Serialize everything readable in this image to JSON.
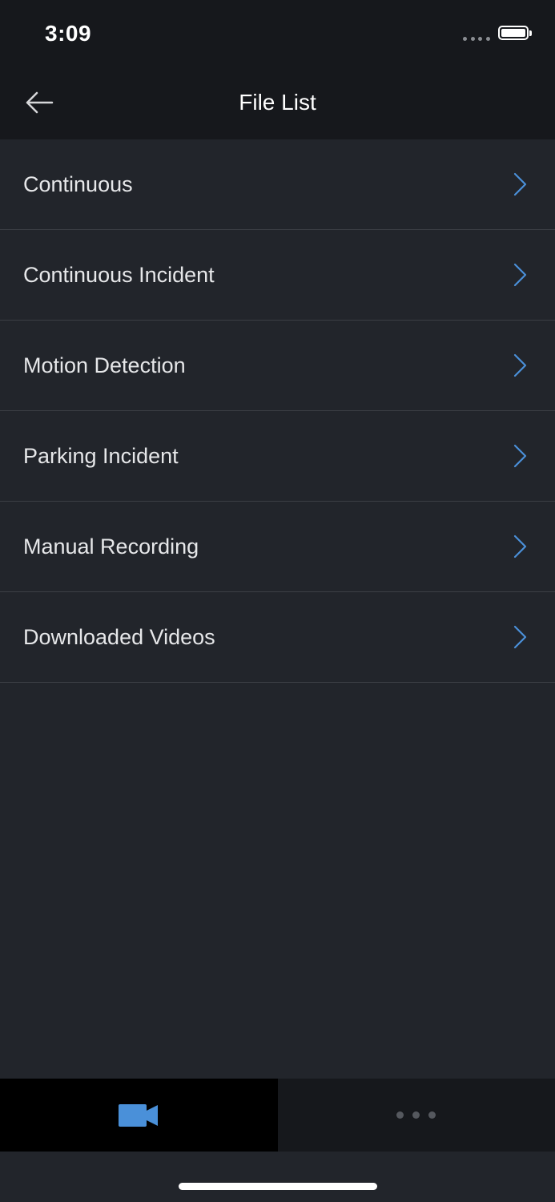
{
  "status_bar": {
    "time": "3:09"
  },
  "nav": {
    "title": "File List",
    "back_icon": "arrow-left-icon"
  },
  "file_list": {
    "items": [
      {
        "label": "Continuous"
      },
      {
        "label": "Continuous Incident"
      },
      {
        "label": "Motion Detection"
      },
      {
        "label": "Parking Incident"
      },
      {
        "label": "Manual Recording"
      },
      {
        "label": "Downloaded Videos"
      }
    ],
    "chevron_icon": "chevron-right-icon"
  },
  "tab_bar": {
    "tabs": [
      {
        "icon": "video-camera-icon",
        "selected": true
      },
      {
        "icon": "more-dots-icon",
        "selected": false
      }
    ]
  },
  "colors": {
    "background": "#22252b",
    "header": "#16181c",
    "accent": "#4a90d9",
    "divider": "#3c3f45",
    "text": "#e6e7e9"
  }
}
